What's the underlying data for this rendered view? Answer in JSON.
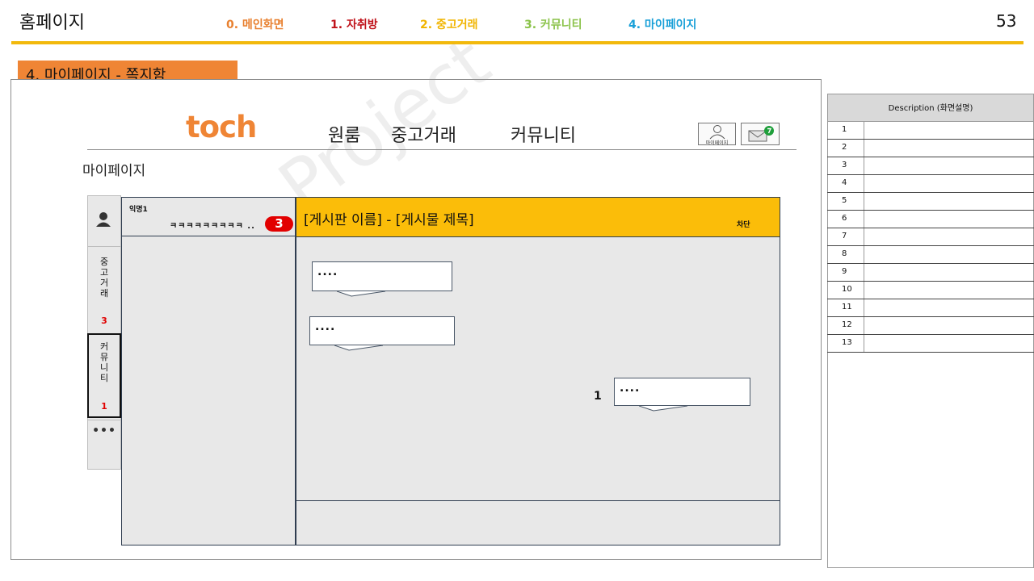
{
  "header": {
    "title": "홈페이지",
    "page_number": "53",
    "tabs": [
      {
        "label": "0. 메인화면",
        "color": "#e8802f"
      },
      {
        "label": "1. 자취방",
        "color": "#c0121a"
      },
      {
        "label": "2. 중고거래",
        "color": "#f1b400"
      },
      {
        "label": "3. 커뮤니티",
        "color": "#8bc34a"
      },
      {
        "label": "4. 마이페이지",
        "color": "#1aa0d8"
      }
    ],
    "rule_color": "#f2b90c"
  },
  "section_label": "4. 마이페이지 - 쪽지함",
  "site": {
    "logo": "toch",
    "menu": [
      "원룸",
      "중고거래",
      "커뮤니티"
    ],
    "mypage_icon_label": "마이페이지",
    "heading": "마이페이지"
  },
  "side_tabs": {
    "used_trade": {
      "label": "중\n고\n거\n래",
      "count": "3"
    },
    "community": {
      "label": "커\n뮤\n니\n티",
      "count": "1"
    },
    "more": "•••"
  },
  "conversation": {
    "sender": "익명1",
    "preview": "ㅋㅋㅋㅋㅋㅋㅋㅋㅋ ..",
    "unread": "3"
  },
  "chat": {
    "title": "[게시판 이름] - [게시물 제목]",
    "block_label": "차단",
    "messages": [
      "....",
      "....",
      "...."
    ],
    "unread_count": "1"
  },
  "description": {
    "header": "Description (화면설명)",
    "rows": [
      "1",
      "2",
      "3",
      "4",
      "5",
      "6",
      "7",
      "8",
      "9",
      "10",
      "11",
      "12",
      "13"
    ]
  },
  "watermark": "Toch Project"
}
